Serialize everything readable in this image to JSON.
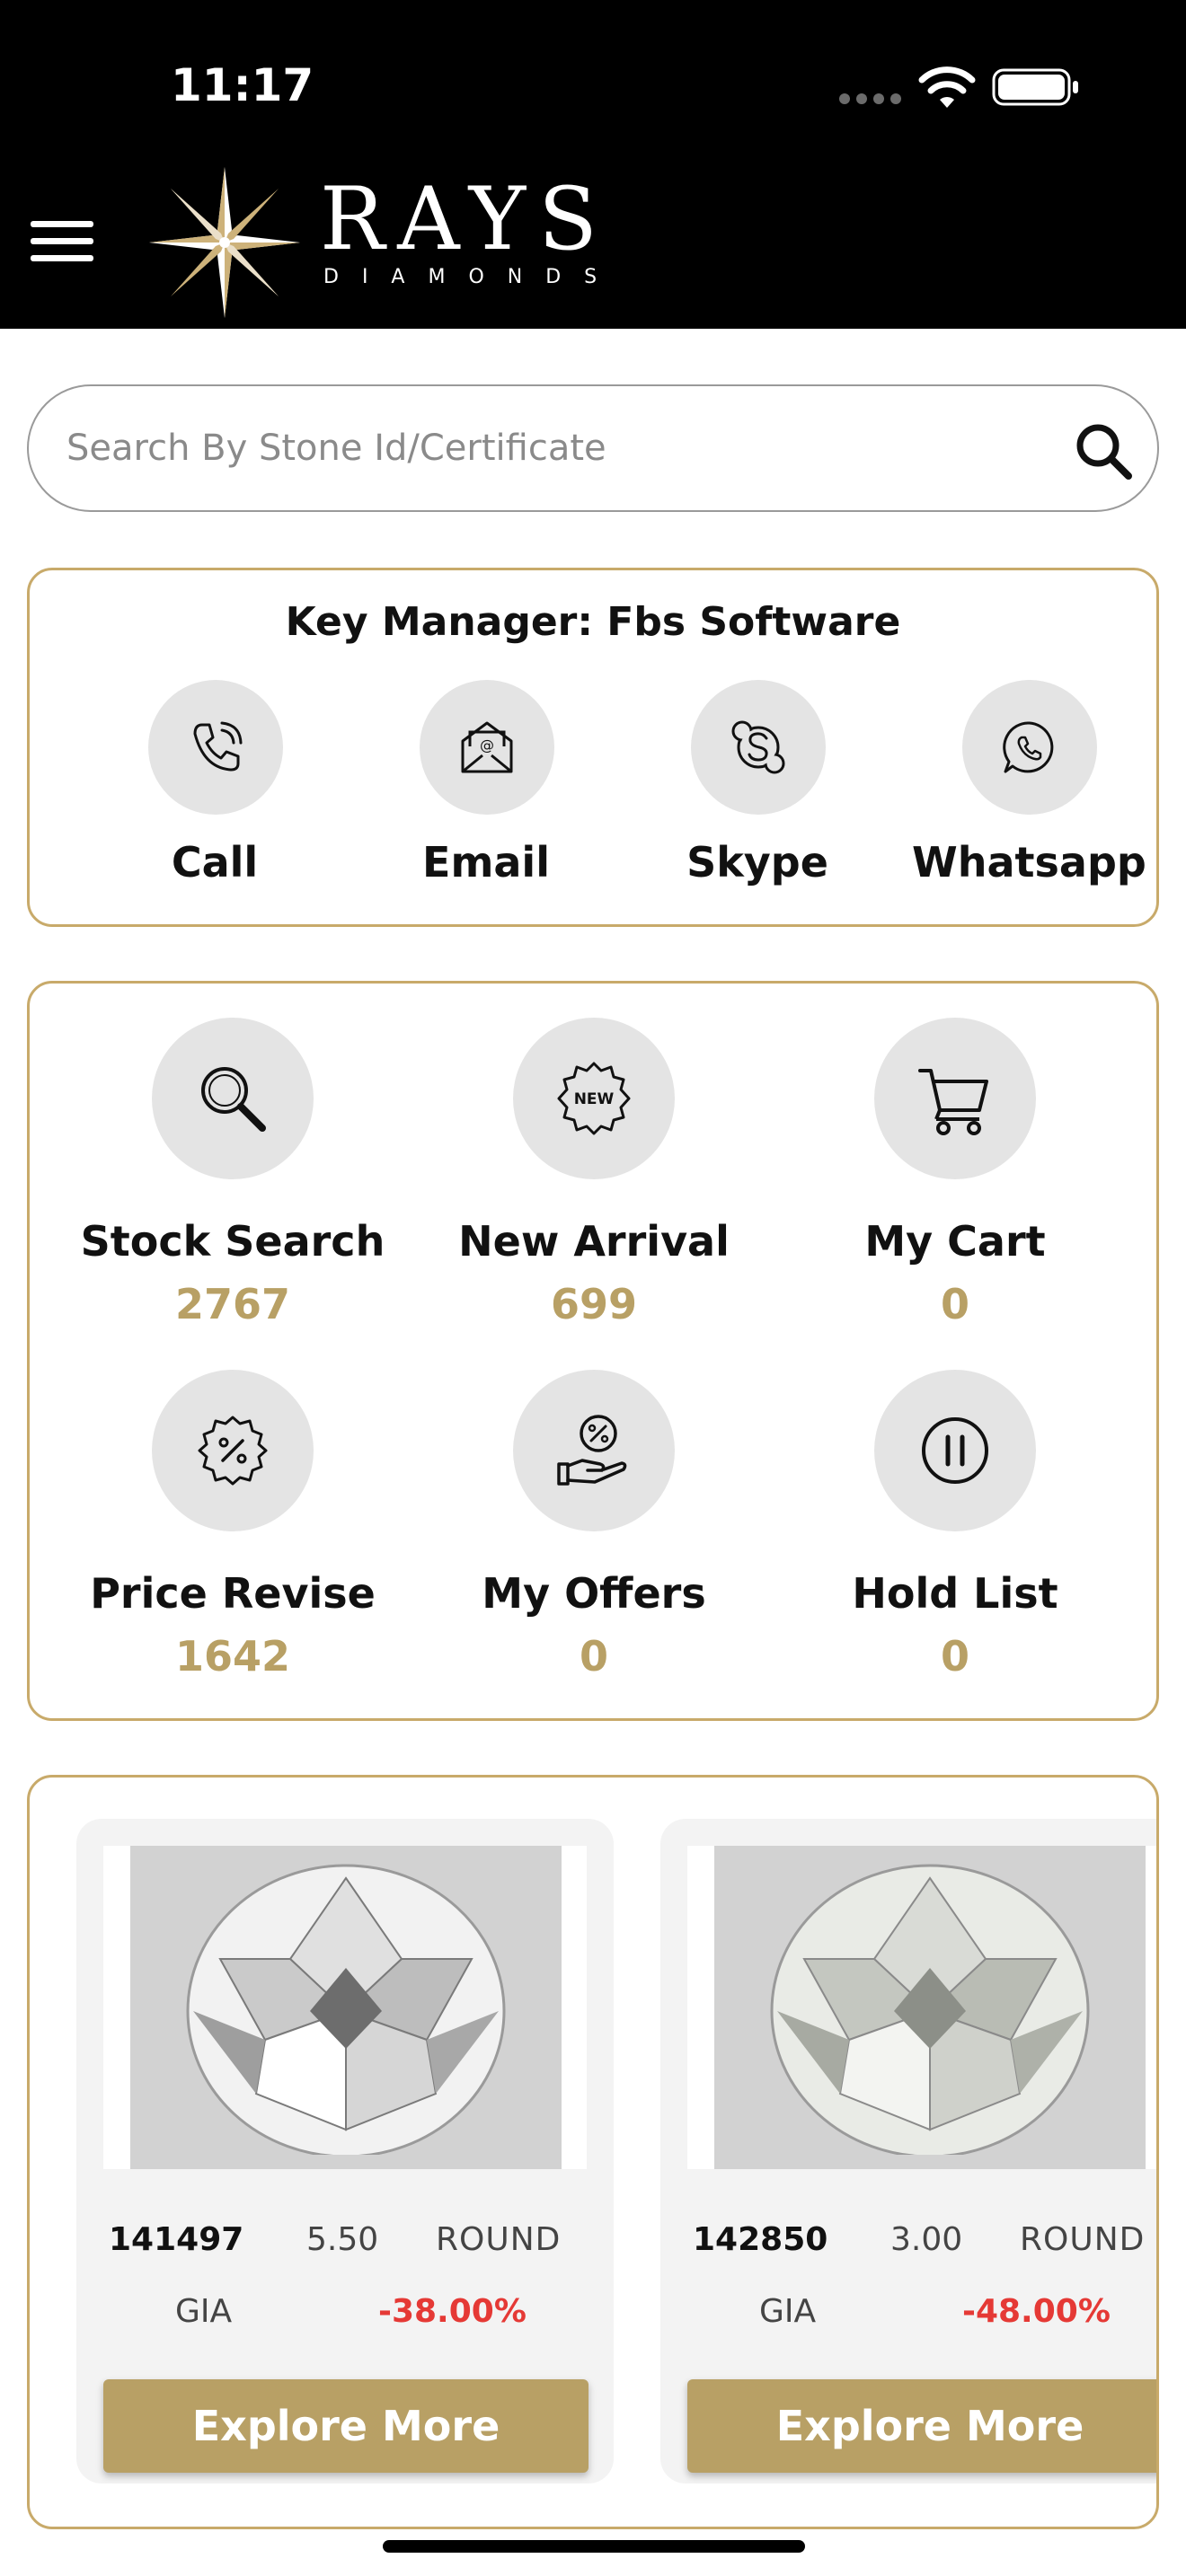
{
  "status_bar": {
    "time": "11:17"
  },
  "header": {
    "brand": "RAYS",
    "brand_sub": "DIAMONDS",
    "menu_icon": "hamburger-menu-icon"
  },
  "search": {
    "placeholder": "Search By Stone Id/Certificate",
    "value": "",
    "icon": "search-icon"
  },
  "key_manager": {
    "title": "Key Manager: Fbs Software",
    "actions": [
      {
        "label": "Call",
        "icon": "phone-icon"
      },
      {
        "label": "Email",
        "icon": "email-icon"
      },
      {
        "label": "Skype",
        "icon": "skype-icon"
      },
      {
        "label": "Whatsapp",
        "icon": "whatsapp-icon"
      }
    ]
  },
  "dashboard": {
    "items": [
      {
        "label": "Stock Search",
        "count": "2767",
        "icon": "magnifier-icon"
      },
      {
        "label": "New Arrival",
        "count": "699",
        "icon": "new-badge-icon"
      },
      {
        "label": "My Cart",
        "count": "0",
        "icon": "cart-icon"
      },
      {
        "label": "Price Revise",
        "count": "1642",
        "icon": "discount-badge-icon"
      },
      {
        "label": "My Offers",
        "count": "0",
        "icon": "offer-hand-icon"
      },
      {
        "label": "Hold List",
        "count": "0",
        "icon": "pause-icon"
      }
    ]
  },
  "products": [
    {
      "stone_id": "141497",
      "weight": "5.50",
      "shape": "ROUND",
      "lab": "GIA",
      "discount": "-38.00%",
      "button": "Explore More"
    },
    {
      "stone_id": "142850",
      "weight": "3.00",
      "shape": "ROUND",
      "lab": "GIA",
      "discount": "-48.00%",
      "button": "Explore More"
    }
  ],
  "colors": {
    "accent_gold": "#b8a065",
    "border_gold": "#c8aa6a",
    "discount_red": "#e53935",
    "header_black": "#000000"
  }
}
